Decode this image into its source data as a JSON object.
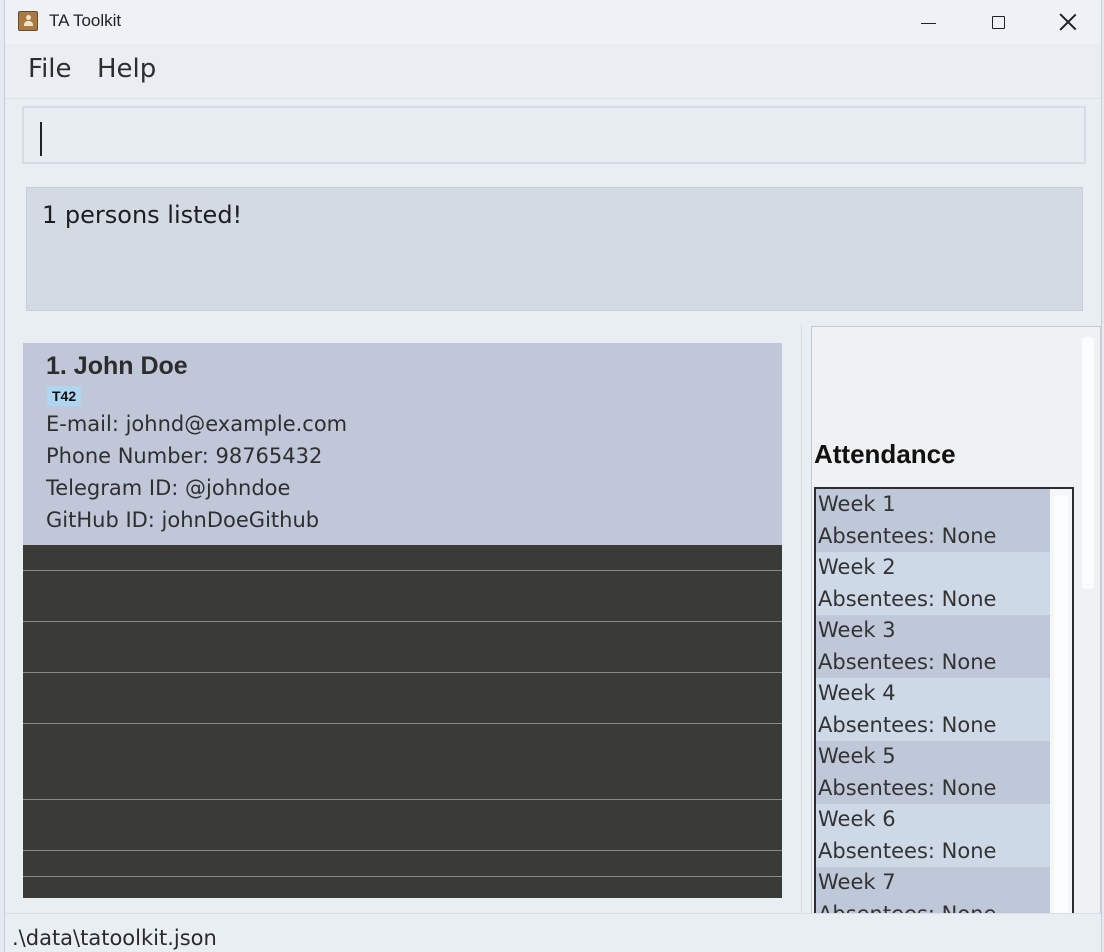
{
  "window": {
    "title": "TA Toolkit"
  },
  "menu": {
    "file_label": "File",
    "help_label": "Help"
  },
  "command": {
    "value": "",
    "placeholder": ""
  },
  "result": {
    "message": "1 persons listed!"
  },
  "persons": [
    {
      "index_name": "1.  John Doe",
      "tag": "T42",
      "email": "E-mail: johnd@example.com",
      "phone": "Phone Number: 98765432",
      "telegram": "Telegram ID: @johndoe",
      "github": "GitHub ID: johnDoeGithub"
    }
  ],
  "attendance": {
    "title": "Attendance",
    "weeks": [
      {
        "week": "Week 1",
        "absentees": "Absentees: None"
      },
      {
        "week": "Week 2",
        "absentees": "Absentees: None"
      },
      {
        "week": "Week 3",
        "absentees": "Absentees: None"
      },
      {
        "week": "Week 4",
        "absentees": "Absentees: None"
      },
      {
        "week": "Week 5",
        "absentees": "Absentees: None"
      },
      {
        "week": "Week 6",
        "absentees": "Absentees: None"
      },
      {
        "week": "Week 7",
        "absentees": "Absentees: None"
      }
    ]
  },
  "status": {
    "file_path": ".\\data\\tatoolkit.json"
  },
  "colors": {
    "card_bg": "#bfc7d9",
    "list_empty_bg": "#3a3a39",
    "tag_bg": "#aed6f1",
    "result_bg": "#d3dae4"
  }
}
